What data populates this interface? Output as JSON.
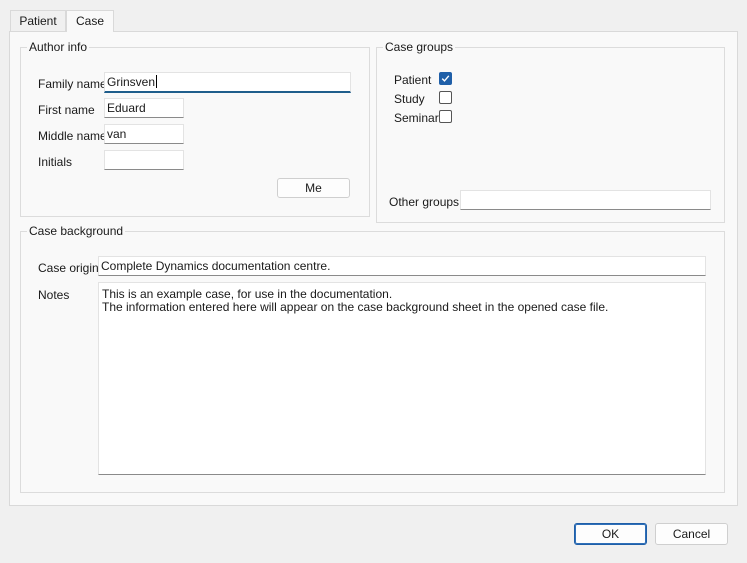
{
  "tabs": [
    {
      "label": "Patient",
      "active": false
    },
    {
      "label": "Case",
      "active": true
    }
  ],
  "author_info": {
    "legend": "Author info",
    "family_name": {
      "label": "Family name",
      "value": "Grinsven"
    },
    "first_name": {
      "label": "First name",
      "value": "Eduard"
    },
    "middle_name": {
      "label": "Middle name",
      "value": "van"
    },
    "initials": {
      "label": "Initials",
      "value": ""
    },
    "me_button": "Me"
  },
  "case_groups": {
    "legend": "Case groups",
    "items": [
      {
        "label": "Patient",
        "checked": true
      },
      {
        "label": "Study",
        "checked": false
      },
      {
        "label": "Seminar",
        "checked": false
      }
    ],
    "other_groups": {
      "label": "Other groups",
      "value": ""
    }
  },
  "case_background": {
    "legend": "Case background",
    "case_origin": {
      "label": "Case origin",
      "value": "Complete Dynamics documentation centre."
    },
    "notes": {
      "label": "Notes",
      "value": "This is an example case, for use in the documentation.\nThe information entered here will appear on the case background sheet in the opened case file."
    }
  },
  "dialog_buttons": {
    "ok": "OK",
    "cancel": "Cancel"
  },
  "colors": {
    "accent": "#1f5fa8",
    "focus_underline": "#1f5e8c"
  }
}
